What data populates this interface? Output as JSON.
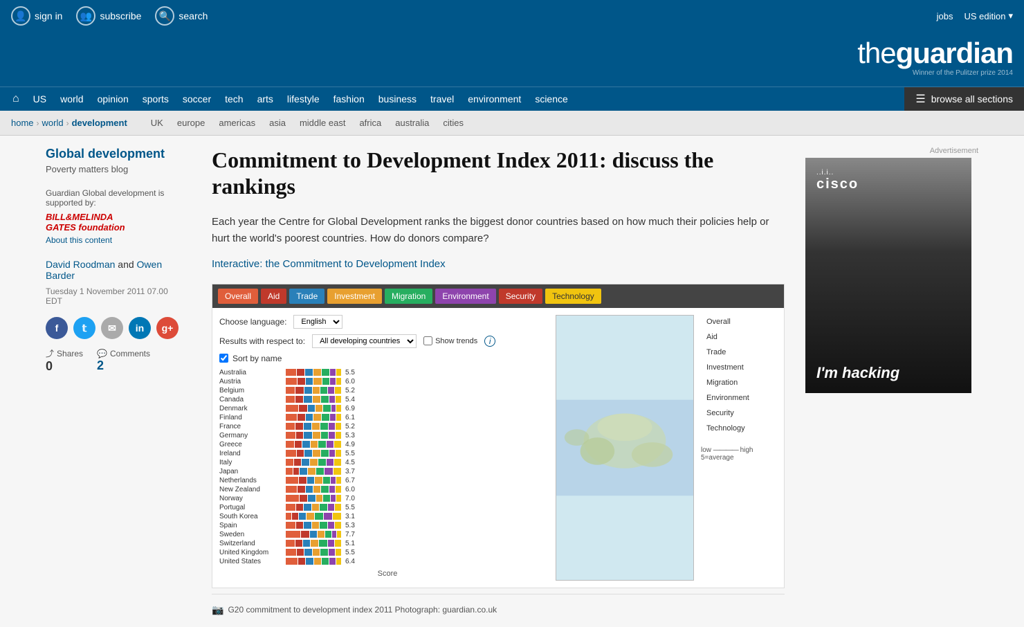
{
  "site": {
    "name": "theguardian",
    "tagline": "Winner of the Pulitzer prize 2014"
  },
  "topbar": {
    "sign_in": "sign in",
    "subscribe": "subscribe",
    "search": "search",
    "jobs": "jobs",
    "edition": "US edition"
  },
  "mainnav": {
    "home_icon": "⌂",
    "links": [
      "US",
      "world",
      "opinion",
      "sports",
      "soccer",
      "tech",
      "arts",
      "lifestyle",
      "fashion",
      "business",
      "travel",
      "environment",
      "science"
    ],
    "browse_all": "browse all sections"
  },
  "breadcrumb": {
    "home": "home",
    "world": "world",
    "development": "development",
    "geo_links": [
      "UK",
      "europe",
      "americas",
      "asia",
      "middle east",
      "africa",
      "australia",
      "cities"
    ]
  },
  "sidebar": {
    "section_title": "Global development",
    "section_subtitle": "Poverty matters blog",
    "sponsor_label": "Guardian Global development is supported by:",
    "gates_logo_line1": "BILL&MELINDA",
    "gates_logo_line2": "GATES foundation",
    "about_content": "About this content",
    "author1": "David Roodman",
    "and": "and",
    "author2": "Owen Barder",
    "date": "Tuesday 1 November 2011 07.00 EDT",
    "shares_label": "Shares",
    "shares_count": "0",
    "comments_label": "Comments",
    "comments_count": "2"
  },
  "article": {
    "title": "Commitment to Development Index 2011: discuss the rankings",
    "intro": "Each year the Centre for Global Development ranks the biggest donor countries based on how much their policies help or hurt the world's poorest countries. How do donors compare?",
    "interactive_link": "Interactive: the Commitment to Development Index"
  },
  "interactive": {
    "tabs": [
      "Overall",
      "Aid",
      "Trade",
      "Investment",
      "Migration",
      "Environment",
      "Security",
      "Technology"
    ],
    "controls": {
      "choose_language": "Choose language:",
      "language_value": "English",
      "results_label": "Results with respect to:",
      "results_value": "All developing countries",
      "show_trends": "Show trends"
    },
    "sort_label": "Sort by name",
    "countries": [
      {
        "name": "Australia",
        "score": "5.5"
      },
      {
        "name": "Austria",
        "score": "6.0"
      },
      {
        "name": "Belgium",
        "score": "5.2"
      },
      {
        "name": "Canada",
        "score": "5.4"
      },
      {
        "name": "Denmark",
        "score": "6.9"
      },
      {
        "name": "Finland",
        "score": "6.1"
      },
      {
        "name": "France",
        "score": "5.2"
      },
      {
        "name": "Germany",
        "score": "5.3"
      },
      {
        "name": "Greece",
        "score": "4.9"
      },
      {
        "name": "Ireland",
        "score": "5.5"
      },
      {
        "name": "Italy",
        "score": "4.5"
      },
      {
        "name": "Japan",
        "score": "3.7"
      },
      {
        "name": "Netherlands",
        "score": "6.7"
      },
      {
        "name": "New Zealand",
        "score": "6.0"
      },
      {
        "name": "Norway",
        "score": "7.0"
      },
      {
        "name": "Portugal",
        "score": "5.5"
      },
      {
        "name": "South Korea",
        "score": "3.1"
      },
      {
        "name": "Spain",
        "score": "5.3"
      },
      {
        "name": "Sweden",
        "score": "7.7"
      },
      {
        "name": "Switzerland",
        "score": "5.1"
      },
      {
        "name": "United Kingdom",
        "score": "5.5"
      },
      {
        "name": "United States",
        "score": "6.4"
      }
    ],
    "legend": [
      "Overall",
      "Aid",
      "Trade",
      "Investment",
      "Migration",
      "Environment",
      "Security",
      "Technology"
    ],
    "score_axis": "Score",
    "legend_scale": "low ——— high\n5=average",
    "caption": "G20 commitment to development index 2011 Photograph: guardian.co.uk"
  },
  "ad": {
    "label": "Advertisement",
    "company": "cisco",
    "company_dots": "..i.i..",
    "tagline": "I'm hacking"
  }
}
